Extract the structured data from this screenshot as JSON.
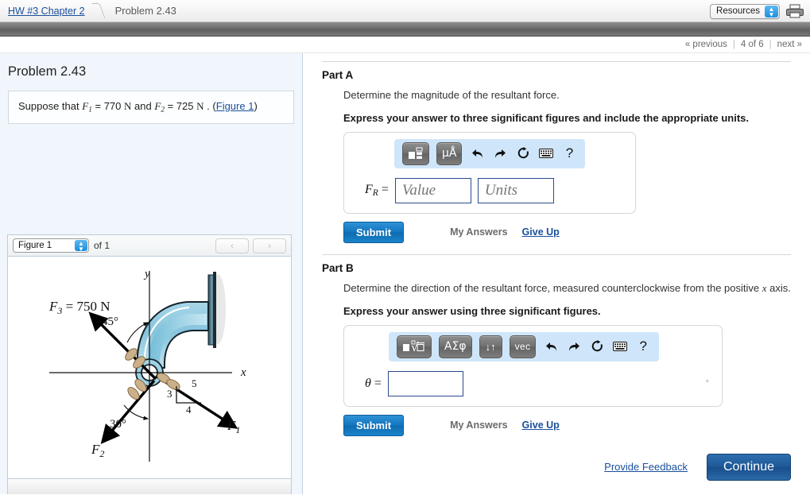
{
  "breadcrumb": {
    "parent": "HW #3 Chapter 2",
    "current": "Problem 2.43"
  },
  "topbar": {
    "resources_label": "Resources",
    "print_icon": "printer-icon"
  },
  "pager": {
    "previous": "« previous",
    "counter": "4 of 6",
    "next": "next »"
  },
  "left": {
    "title": "Problem 2.43",
    "statement": {
      "prefix": "Suppose that",
      "f1_symbol": "F",
      "f1_sub": "1",
      "eq1": "= 770",
      "unit1": "N",
      "and": "and",
      "f2_symbol": "F",
      "f2_sub": "2",
      "eq2": "= 725",
      "unit2": "N",
      "period": ".",
      "figure_link": "Figure 1"
    },
    "figure_bar": {
      "selected": "Figure 1",
      "of_label": "of 1",
      "prev_arrow": "‹",
      "next_arrow": "›"
    }
  },
  "figure": {
    "axis_x": "x",
    "axis_y": "y",
    "f3_label": "F",
    "f3_sub": "3",
    "f3_value": "= 750 N",
    "angle_45": "45°",
    "angle_30": "30°",
    "f1_label": "F",
    "f1_sub": "1",
    "f2_label": "F",
    "f2_sub": "2",
    "slope_3": "3",
    "slope_4": "4",
    "slope_5": "5"
  },
  "partA": {
    "heading": "Part A",
    "question": "Determine the magnitude of the resultant force.",
    "instruction": "Express your answer to three significant figures and include the appropriate units.",
    "toolbar": [
      {
        "name": "template-icon",
        "label": "■□"
      },
      {
        "name": "units-icon",
        "label": "μÅ"
      },
      {
        "name": "undo-icon",
        "label": "↩"
      },
      {
        "name": "redo-icon",
        "label": "↪"
      },
      {
        "name": "reset-icon",
        "label": "↻"
      },
      {
        "name": "keyboard-icon",
        "label": "⌨"
      },
      {
        "name": "help-icon",
        "label": "?"
      }
    ],
    "field_label": "F",
    "field_sub": "R",
    "field_eq": "=",
    "value_placeholder": "Value",
    "units_placeholder": "Units",
    "submit": "Submit",
    "my_answers": "My Answers",
    "give_up": "Give Up"
  },
  "partB": {
    "heading": "Part B",
    "question": "Determine the direction of the resultant force, measured counterclockwise from the positive x axis.",
    "question_pre": "Determine the direction of the resultant force, measured counterclockwise from the positive",
    "question_var": "x",
    "question_post": "axis.",
    "instruction": "Express your answer using three significant figures.",
    "toolbar": [
      {
        "name": "sqrt-template-icon",
        "label": "■√□"
      },
      {
        "name": "greek-icon",
        "label": "ΑΣφ"
      },
      {
        "name": "arrows-icon",
        "label": "↓↑"
      },
      {
        "name": "vector-icon",
        "label": "vec"
      },
      {
        "name": "undo-icon",
        "label": "↩"
      },
      {
        "name": "redo-icon",
        "label": "↪"
      },
      {
        "name": "reset-icon",
        "label": "↻"
      },
      {
        "name": "keyboard-icon",
        "label": "⌨"
      },
      {
        "name": "help-icon",
        "label": "?"
      }
    ],
    "field_label": "θ",
    "field_eq": "=",
    "field_value": "",
    "degree": "°",
    "submit": "Submit",
    "my_answers": "My Answers",
    "give_up": "Give Up"
  },
  "footer": {
    "feedback": "Provide Feedback",
    "continue": "Continue"
  },
  "colors": {
    "link": "#1a4f9c",
    "submit_blue": "#1275bf",
    "continue_blue": "#1d5796",
    "toolbar_bg": "#cfe6fa",
    "left_panel_bg": "#f0f6fb",
    "pipe_blue": "#8fc7dd"
  }
}
